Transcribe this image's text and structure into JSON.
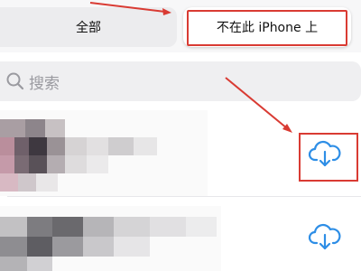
{
  "segment_control": {
    "all_label": "全部",
    "not_on_device_label": "不在此 iPhone 上",
    "selected": "not_on_device"
  },
  "search": {
    "placeholder": "搜索",
    "icon": "search-icon"
  },
  "items": [
    {
      "icon": "cloud-download-icon",
      "thumbnail": "pixelated-thumbnail"
    },
    {
      "icon": "cloud-download-icon",
      "thumbnail": "pixelated-thumbnail"
    }
  ],
  "colors": {
    "accent": "#2e8ee6",
    "annotation_red": "#d93b33",
    "segment_background": "#ececee",
    "search_background": "#efeff1"
  }
}
